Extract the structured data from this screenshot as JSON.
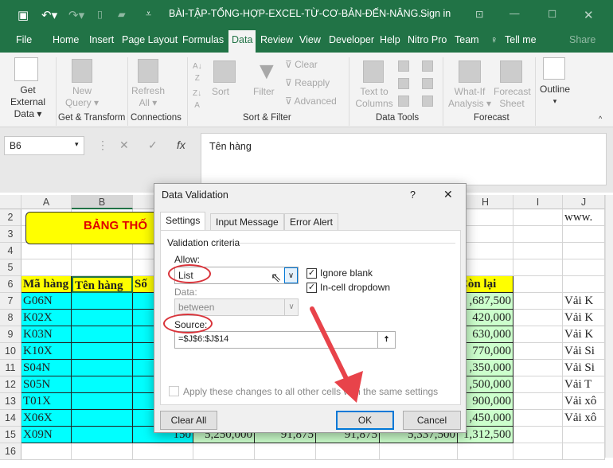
{
  "titlebar": {
    "title": "BÀI-TẬP-TỔNG-HỢP-EXCEL-TỪ-CƠ-BẢN-ĐẾN-NÂNG...",
    "sign_in": "Sign in",
    "icons": [
      "save-icon",
      "undo-icon",
      "redo-icon",
      "new-icon",
      "open-icon",
      "customize-icon",
      "ribbon-display-icon",
      "minimize-icon",
      "maximize-icon",
      "close-icon"
    ]
  },
  "tabs": [
    "File",
    "Home",
    "Insert",
    "Page Layout",
    "Formulas",
    "Data",
    "Review",
    "View",
    "Developer",
    "Help",
    "Nitro Pro",
    "Team",
    "Tell me",
    "Share"
  ],
  "active_tab": "Data",
  "ribbon": {
    "get_external": "Get External",
    "get_external2": "Data ▾",
    "new_query": "New",
    "new_query2": "Query ▾",
    "refresh": "Refresh",
    "refresh2": "All ▾",
    "sort": "Sort",
    "filter": "Filter",
    "clear": "Clear",
    "reapply": "Reapply",
    "advanced": "Advanced",
    "text_to": "Text to",
    "columns": "Columns",
    "whatif": "What-If",
    "analysis": "Analysis ▾",
    "forecast": "Forecast",
    "sheet": "Sheet",
    "outline": "Outline",
    "outline2": "▾",
    "groups": [
      "Get & Transform",
      "Connections",
      "Sort & Filter",
      "Data Tools",
      "Forecast"
    ]
  },
  "formula_bar": {
    "name_box": "B6",
    "fx": "fx",
    "value": "Tên hàng"
  },
  "columns": [
    "A",
    "B",
    "C",
    "D",
    "E",
    "F",
    "G",
    "H",
    "I",
    "J"
  ],
  "rows": [
    "2",
    "3",
    "4",
    "5",
    "6",
    "7",
    "8",
    "9",
    "10",
    "11",
    "12",
    "13",
    "14",
    "15",
    "16"
  ],
  "sheet": {
    "banner": "BẢNG THỐ",
    "j2": "www.",
    "headers": {
      "a": "Mã hàng",
      "b": "Tên hàng",
      "c": "Số",
      "h": "Còn lại"
    },
    "codes": [
      "G06N",
      "K02X",
      "K03N",
      "K10X",
      "S04N",
      "S05N",
      "T01X",
      "X06X",
      "X09N"
    ],
    "con_lai": [
      ",687,500",
      "420,000",
      "630,000",
      "770,000",
      ",350,000",
      ",500,000",
      "900,000",
      ",450,000",
      "1,312,500"
    ],
    "j_col": [
      "Vải K",
      "Vải K",
      "Vải K",
      "Vải Si",
      "Vải Si",
      "Vải T",
      "Vải xô",
      "Vải xô"
    ],
    "row15": {
      "c": "150",
      "d": "5,250,000",
      "e": "91,875",
      "f": "91,875",
      "g": "5,337,500"
    }
  },
  "dialog": {
    "title": "Data Validation",
    "help": "?",
    "close": "✕",
    "tabs": [
      "Settings",
      "Input Message",
      "Error Alert"
    ],
    "criteria": "Validation criteria",
    "allow_label": "Allow:",
    "allow_value": "List",
    "ignore_blank": "Ignore blank",
    "in_cell": "In-cell dropdown",
    "data_label": "Data:",
    "data_value": "between",
    "source_label": "Source:",
    "source_value": "=$J$6:$J$14",
    "apply_all": "Apply these changes to all other cells with the same settings",
    "clear_all": "Clear All",
    "ok": "OK",
    "cancel": "Cancel",
    "ignore_blank_checked": true,
    "in_cell_checked": true,
    "apply_all_checked": false
  },
  "colors": {
    "excel_green": "#217346",
    "annotation_red": "#d9343b",
    "cyan": "#00ffff",
    "yellow": "#ffff00",
    "light_green": "#ccffcc"
  }
}
